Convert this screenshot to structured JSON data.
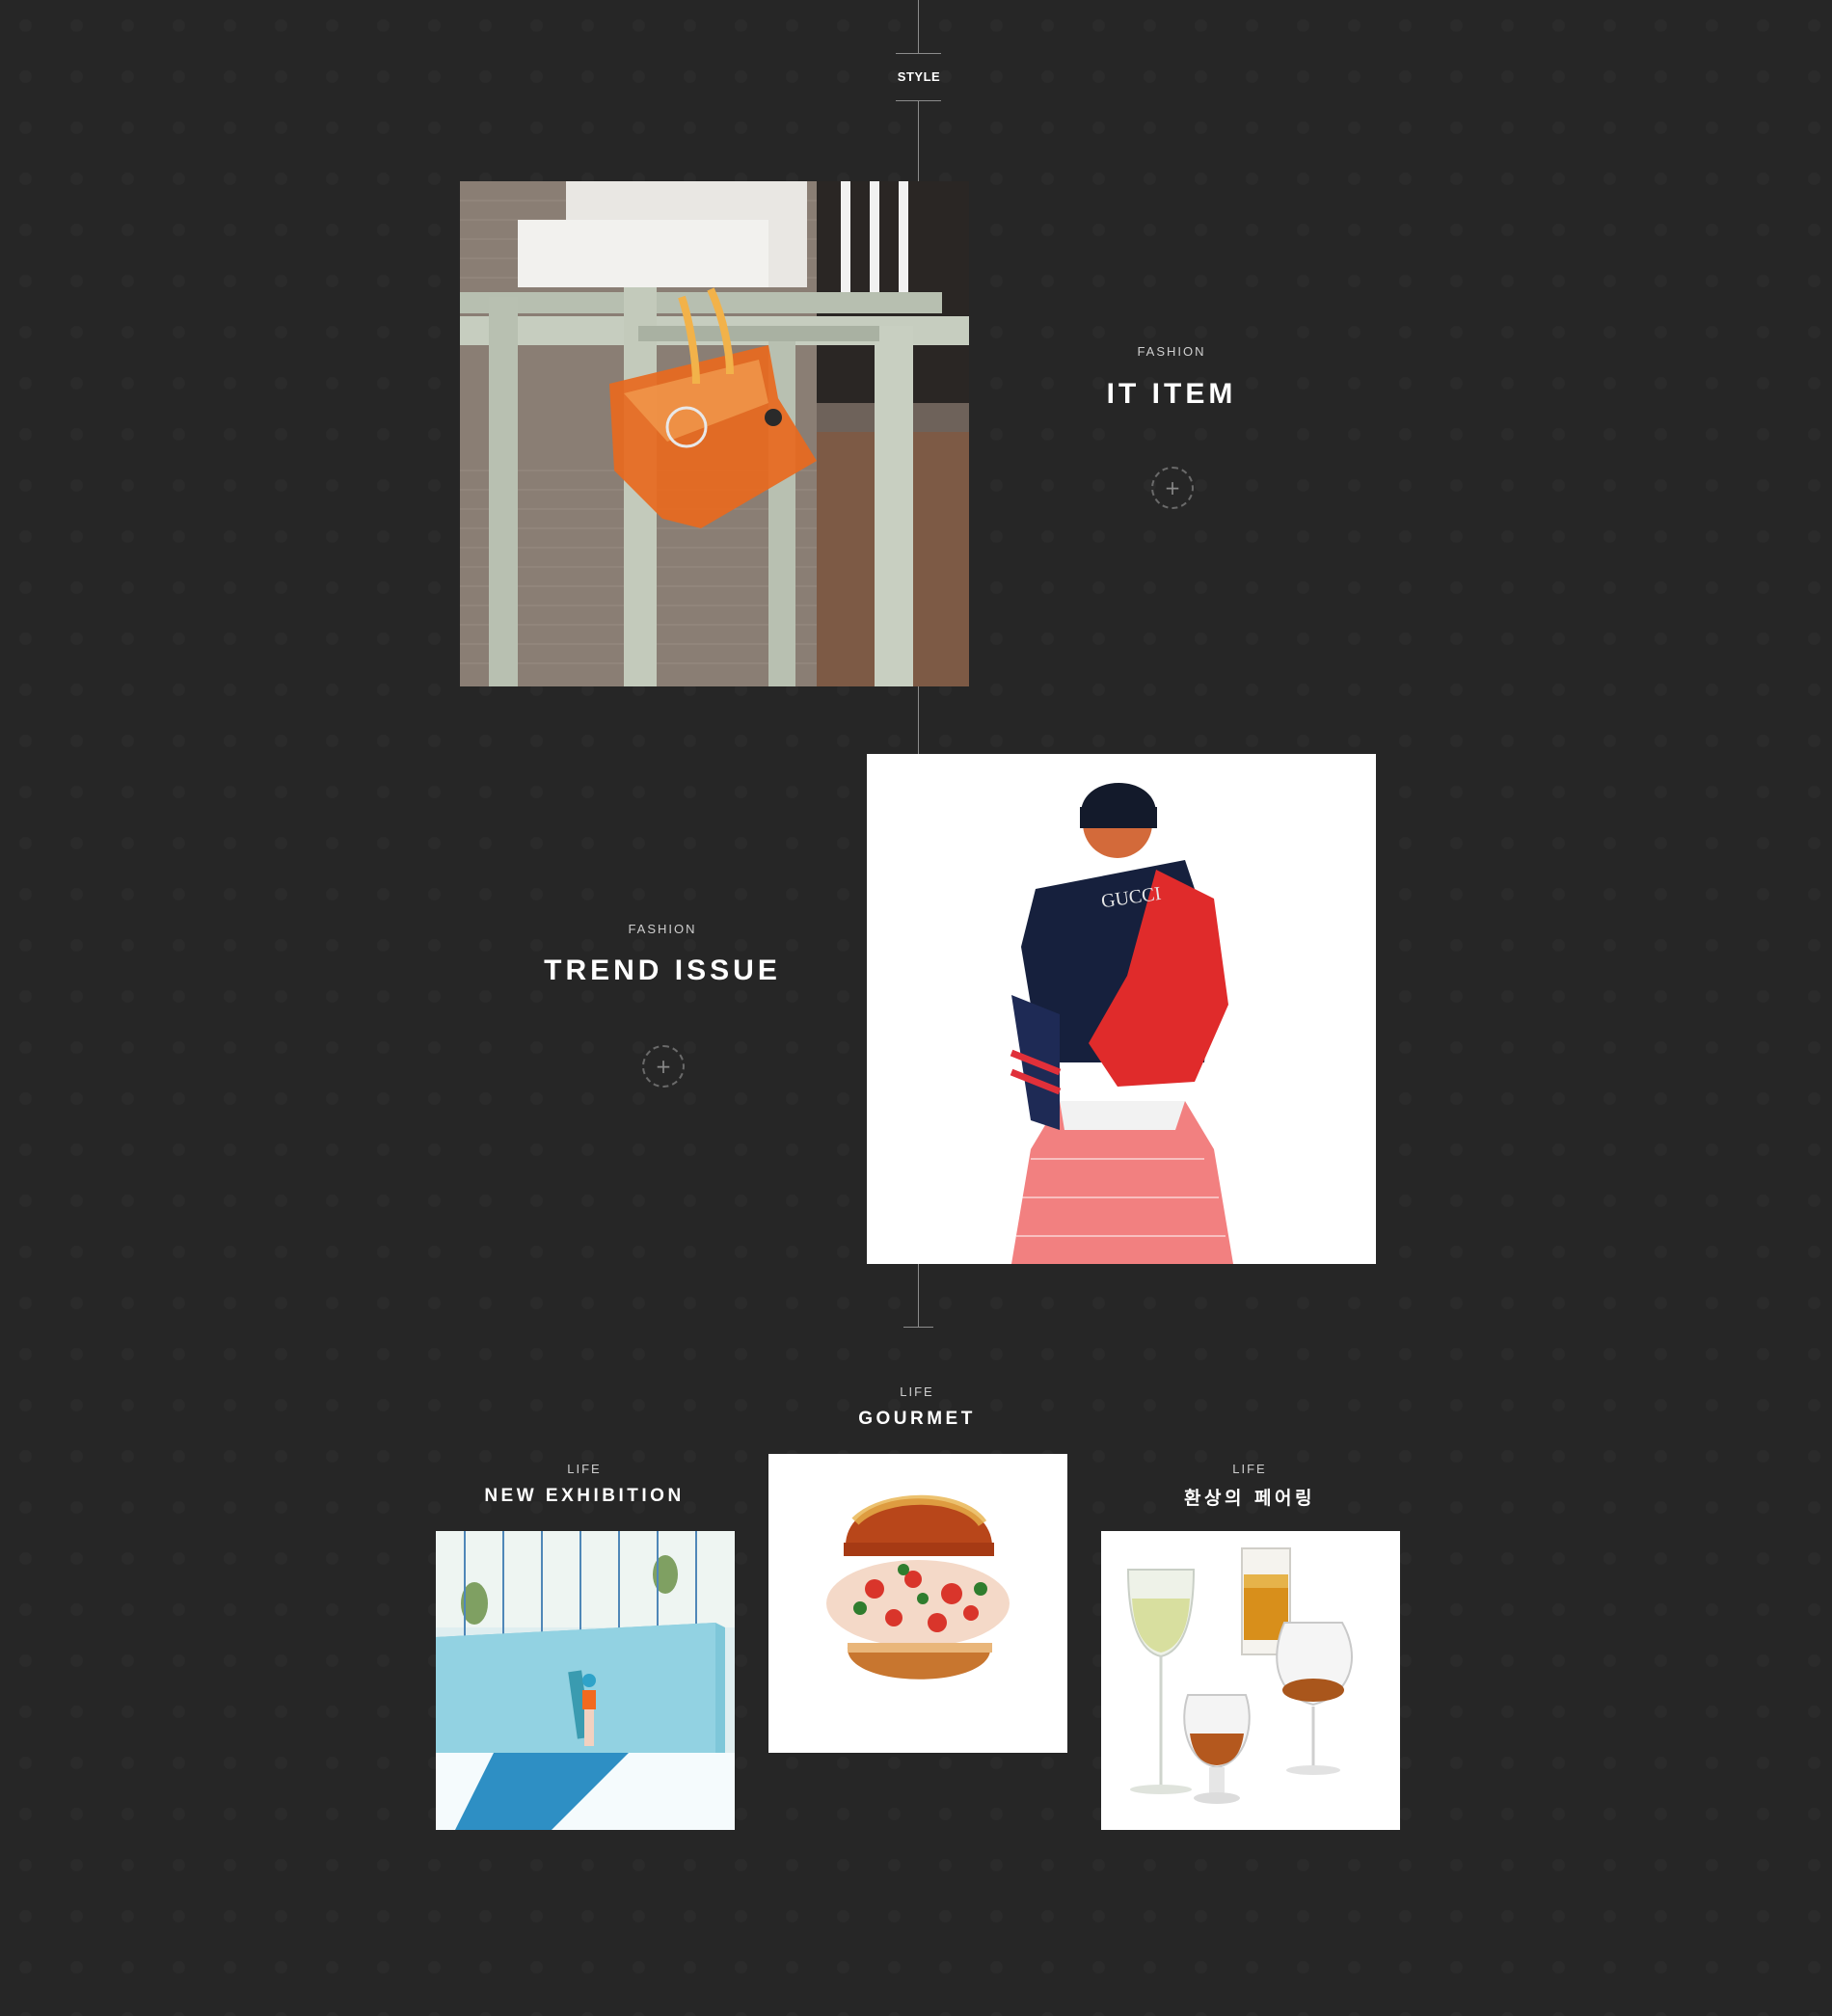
{
  "section": {
    "label": "STYLE"
  },
  "features": [
    {
      "category": "FASHION",
      "title": "IT ITEM",
      "image": "orange-bag-photo",
      "more_icon": "plus-icon",
      "more_glyph": "+"
    },
    {
      "category": "FASHION",
      "title": "TREND ISSUE",
      "image": "gucci-fashion-photo",
      "more_icon": "plus-icon",
      "more_glyph": "+"
    }
  ],
  "life": [
    {
      "category": "LIFE",
      "title": "NEW EXHIBITION",
      "image": "exhibition-photo"
    },
    {
      "category": "LIFE",
      "title": "GOURMET",
      "image": "lobster-burger-photo"
    },
    {
      "category": "LIFE",
      "title": "환상의 페어링",
      "image": "glasses-photo"
    }
  ],
  "graphics": {
    "gucci_text": "GUCCI"
  },
  "colors": {
    "background": "#262626",
    "line": "#8c8c8c",
    "text": "#ffffff",
    "subtext": "#cfcfcf"
  }
}
